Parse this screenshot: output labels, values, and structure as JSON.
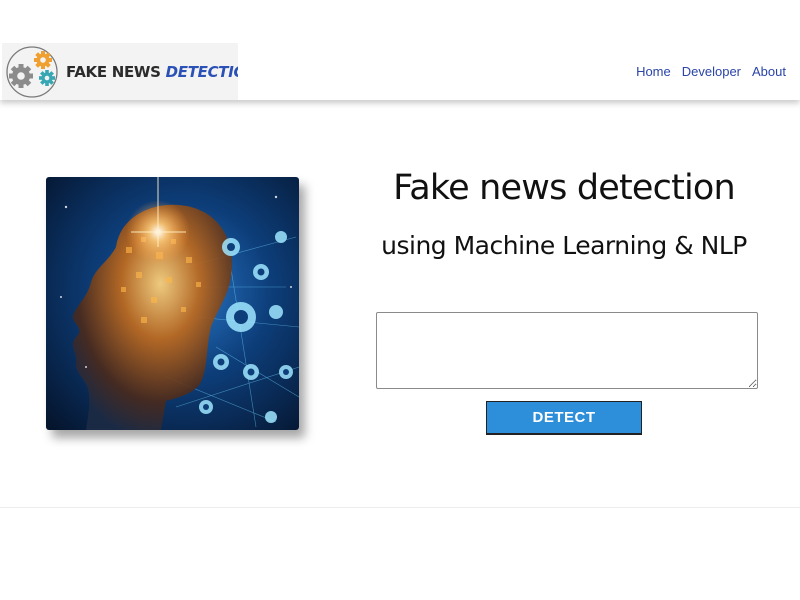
{
  "header": {
    "logo": {
      "word1": "FAKE NEWS",
      "word2": "DETECTION"
    },
    "nav": [
      "Home",
      "Developer",
      "About"
    ]
  },
  "hero": {
    "image_icon": "ai-brain-network-image",
    "title": "Fake news detection",
    "subtitle": "using Machine Learning & NLP"
  },
  "form": {
    "input_value": "",
    "button_label": "DETECT",
    "button_color": "#2d8fd9"
  }
}
